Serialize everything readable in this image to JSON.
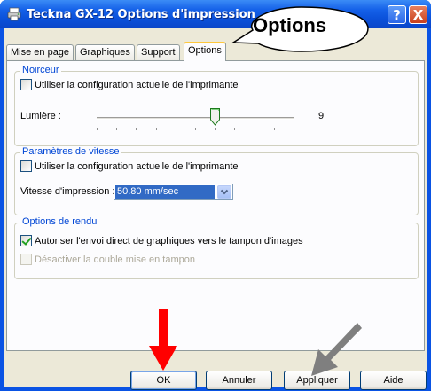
{
  "window": {
    "title": "Teckna GX-12 Options d'impression",
    "help_label": "?",
    "close_label": "X"
  },
  "tabs": [
    {
      "label": "Mise en page"
    },
    {
      "label": "Graphiques"
    },
    {
      "label": "Support"
    },
    {
      "label": "Options"
    }
  ],
  "callout": {
    "text": "Options"
  },
  "noirceur": {
    "legend": "Noirceur",
    "use_printer_label": "Utiliser la configuration actuelle de l'imprimante",
    "use_printer_checked": false,
    "lumiere_label": "Lumière :",
    "lumiere_value": "9",
    "slider_level_fraction": 0.6
  },
  "vitesse": {
    "legend": "Paramètres de vitesse",
    "use_printer_label": "Utiliser la configuration actuelle de l'imprimante",
    "use_printer_checked": false,
    "speed_label": "Vitesse d'impression :",
    "speed_value": "50.80 mm/sec"
  },
  "rendu": {
    "legend": "Options de rendu",
    "direct_label": "Autoriser l'envoi direct de graphiques vers le tampon d'images",
    "direct_checked": true,
    "double_label": "Désactiver la double mise en tampon",
    "double_checked": false,
    "double_disabled": true
  },
  "buttons": {
    "ok": "OK",
    "cancel": "Annuler",
    "apply": "Appliquer",
    "help": "Aide"
  },
  "colors": {
    "title_bar": "#0a53e4",
    "legend_text": "#0046d5",
    "red_arrow": "#ff0000",
    "gray_arrow": "#808080"
  }
}
